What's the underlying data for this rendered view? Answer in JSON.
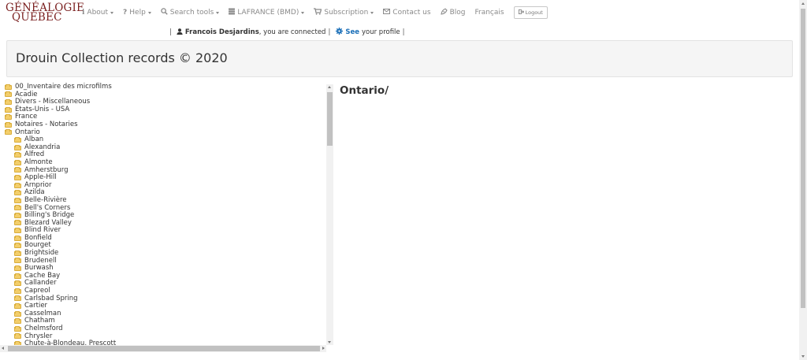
{
  "logo": {
    "line1": "GÉNÉALOGIE",
    "line2": "QUÉBEC"
  },
  "nav": {
    "about": {
      "icon": "info-icon",
      "label": "About"
    },
    "help": {
      "icon": "question-icon",
      "label": "Help"
    },
    "search_tools": {
      "icon": "search-icon",
      "label": "Search tools"
    },
    "lafrance": {
      "icon": "database-icon",
      "label": "LAFRANCE (BMD)"
    },
    "subscription": {
      "icon": "cart-icon",
      "label": "Subscription"
    },
    "contact": {
      "icon": "envelope-icon",
      "label": "Contact us"
    },
    "blog": {
      "icon": "blog-icon",
      "label": "Blog"
    },
    "language": {
      "label": "Français"
    },
    "logout": {
      "icon": "sign-out-icon",
      "label": "Logout"
    }
  },
  "connected": {
    "user_name": "Francois Desjardins",
    "status_text": ", you are connected",
    "see_label": "See",
    "profile_text": "your profile"
  },
  "page": {
    "title": "Drouin Collection records © 2020",
    "content_title": "Ontario/"
  },
  "tree": {
    "root_items": [
      "00_Inventaire des microfilms",
      "Acadie",
      "Divers - Miscellaneous",
      "États-Unis - USA",
      "France",
      "Notaires - Notaries",
      "Ontario"
    ],
    "ontario_children": [
      "Alban",
      "Alexandria",
      "Alfred",
      "Almonte",
      "Amherstburg",
      "Apple-Hill",
      "Arnprior",
      "Azilda",
      "Belle-Rivière",
      "Bell's Corners",
      "Billing's Bridge",
      "Blezard Valley",
      "Blind River",
      "Bonfield",
      "Bourget",
      "Brightside",
      "Brudenell",
      "Burwash",
      "Cache Bay",
      "Callander",
      "Capreol",
      "Carlsbad Spring",
      "Cartier",
      "Casselman",
      "Chatham",
      "Chelmsford",
      "Chrysler",
      "Chute-à-Blondeau, Prescott"
    ]
  },
  "colors": {
    "link_blue": "#1a6fb8",
    "logo_red": "#7a1f1f",
    "folder_yellow": "#f3ce6b",
    "nav_gray": "#8a8a8a"
  }
}
